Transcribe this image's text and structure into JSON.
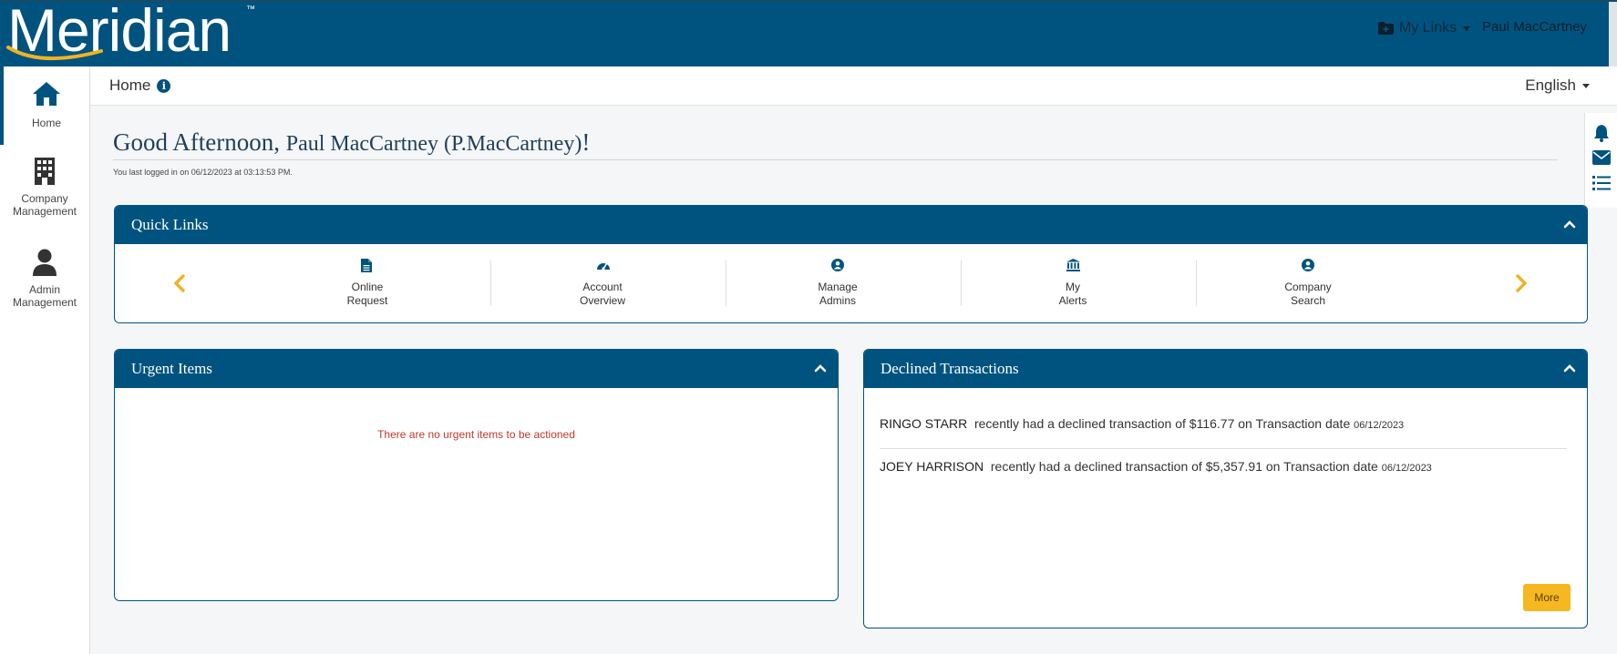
{
  "header": {
    "logo_text": "Meridian",
    "logo_tm": "™",
    "my_links_label": "My Links",
    "user_name": "Paul MacCartney"
  },
  "sidebar": {
    "items": [
      {
        "label": "Home",
        "icon": "home-icon"
      },
      {
        "label": "Company Management",
        "icon": "building-icon"
      },
      {
        "label": "Admin Management",
        "icon": "person-icon"
      }
    ]
  },
  "breadcrumb": {
    "label": "Home"
  },
  "language": {
    "label": "English"
  },
  "greeting": {
    "prefix": "Good Afternoon,",
    "name": "Paul MacCartney (P.MacCartney)",
    "suffix": "!",
    "last_login": "You last logged in on 06/12/2023 at 03:13:53 PM."
  },
  "quick_links": {
    "title": "Quick Links",
    "items": [
      {
        "line1": "Online",
        "line2": "Request",
        "icon": "document-icon"
      },
      {
        "line1": "Account",
        "line2": "Overview",
        "icon": "speedometer-icon"
      },
      {
        "line1": "Manage",
        "line2": "Admins",
        "icon": "user-circle-icon"
      },
      {
        "line1": "My",
        "line2": "Alerts",
        "icon": "bank-icon"
      },
      {
        "line1": "Company",
        "line2": "Search",
        "icon": "user-circle-icon"
      }
    ]
  },
  "urgent_items": {
    "title": "Urgent Items",
    "empty_message": "There are no urgent items to be actioned"
  },
  "declined": {
    "title": "Declined Transactions",
    "rows": [
      {
        "name": "RINGO STARR",
        "text": "recently had a declined transaction of $116.77 on Transaction date",
        "date": "06/12/2023"
      },
      {
        "name": "JOEY HARRISON",
        "text": "recently had a declined transaction of $5,357.91 on Transaction date",
        "date": "06/12/2023"
      }
    ],
    "more_label": "More"
  },
  "colors": {
    "primary": "#00537f",
    "accent": "#f6b820",
    "logo_swoosh": "#f0b323",
    "urgent_text": "#c0392b"
  }
}
